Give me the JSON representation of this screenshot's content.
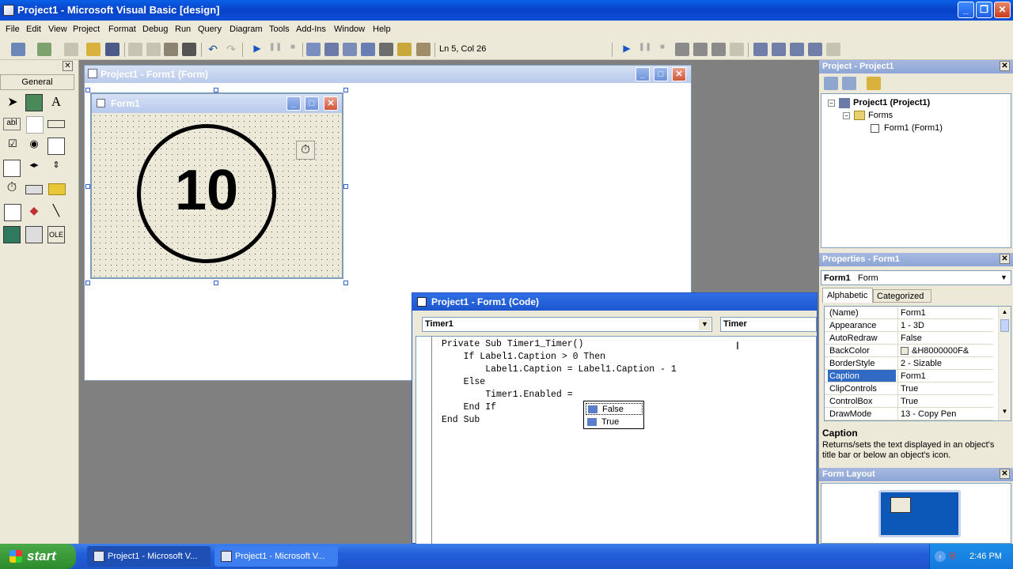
{
  "app": {
    "title": "Project1 - Microsoft Visual Basic [design]"
  },
  "menu": [
    "File",
    "Edit",
    "View",
    "Project",
    "Format",
    "Debug",
    "Run",
    "Query",
    "Diagram",
    "Tools",
    "Add-Ins",
    "Window",
    "Help"
  ],
  "toolbar": {
    "position": "Ln 5, Col 26"
  },
  "toolbox": {
    "title": "General"
  },
  "form_designer": {
    "title": "Project1 - Form1 (Form)",
    "form_caption": "Form1",
    "label_text": "10"
  },
  "code_window": {
    "title": "Project1 - Form1 (Code)",
    "object_combo": "Timer1",
    "proc_combo": "Timer",
    "lines": [
      "Private Sub Timer1_Timer()",
      "    If Label1.Caption > 0 Then",
      "        Label1.Caption = Label1.Caption - 1",
      "    Else",
      "        Timer1.Enabled =",
      "    End If",
      "End Sub"
    ],
    "autocomplete": [
      "False",
      "True"
    ]
  },
  "project_explorer": {
    "title": "Project - Project1",
    "tree": [
      "Project1 (Project1)",
      "Forms",
      "Form1 (Form1)"
    ]
  },
  "properties": {
    "title": "Properties - Form1",
    "object": "Form1",
    "object_type": "Form",
    "tabs": [
      "Alphabetic",
      "Categorized"
    ],
    "rows": [
      {
        "k": "(Name)",
        "v": "Form1"
      },
      {
        "k": "Appearance",
        "v": "1 - 3D"
      },
      {
        "k": "AutoRedraw",
        "v": "False"
      },
      {
        "k": "BackColor",
        "v": "&H8000000F&"
      },
      {
        "k": "BorderStyle",
        "v": "2 - Sizable"
      },
      {
        "k": "Caption",
        "v": "Form1"
      },
      {
        "k": "ClipControls",
        "v": "True"
      },
      {
        "k": "ControlBox",
        "v": "True"
      },
      {
        "k": "DrawMode",
        "v": "13 - Copy Pen"
      }
    ],
    "desc_title": "Caption",
    "desc_text": "Returns/sets the text displayed in an object's title bar or below an object's icon."
  },
  "form_layout": {
    "title": "Form Layout"
  },
  "taskbar": {
    "start": "start",
    "tasks": [
      "Project1 - Microsoft V...",
      "Project1 - Microsoft V..."
    ],
    "clock": "2:46 PM"
  }
}
